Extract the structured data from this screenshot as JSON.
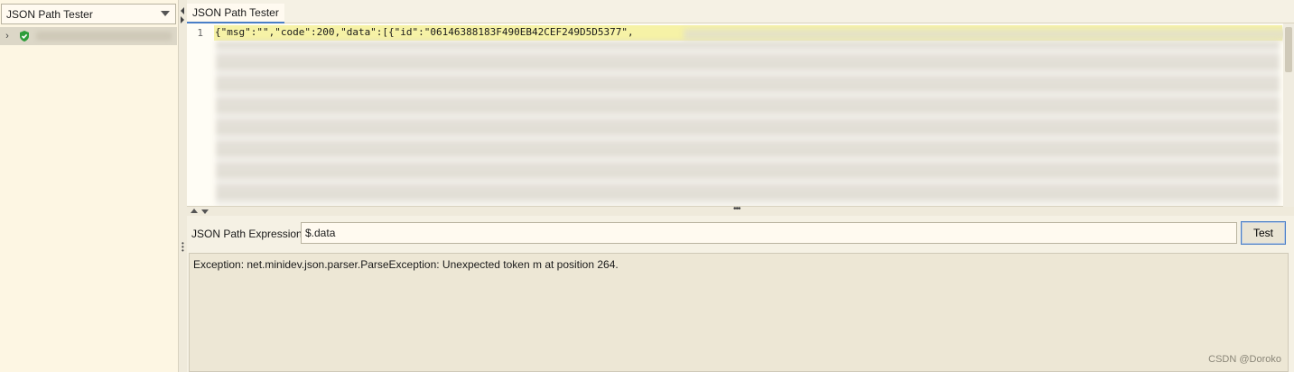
{
  "left_panel": {
    "viewer_select": "JSON Path Tester",
    "tree": [
      {
        "icon": "green-shield-check-icon"
      }
    ]
  },
  "tab": {
    "label": "JSON Path Tester"
  },
  "editor": {
    "line_number": "1",
    "line1_text": "{\"msg\":\"\",\"code\":200,\"data\":[{\"id\":\"06146388183F490EB42CEF249D5D5377\","
  },
  "expression": {
    "label": "JSON Path Expression",
    "value": "$.data",
    "test_label": "Test"
  },
  "result": {
    "text": "Exception: net.minidev.json.parser.ParseException: Unexpected token m at position 264."
  },
  "watermark": "CSDN @Doroko",
  "colors": {
    "accent": "#4a7fc7",
    "highlight": "#f6f2a6",
    "shield": "#2e9d3a"
  }
}
